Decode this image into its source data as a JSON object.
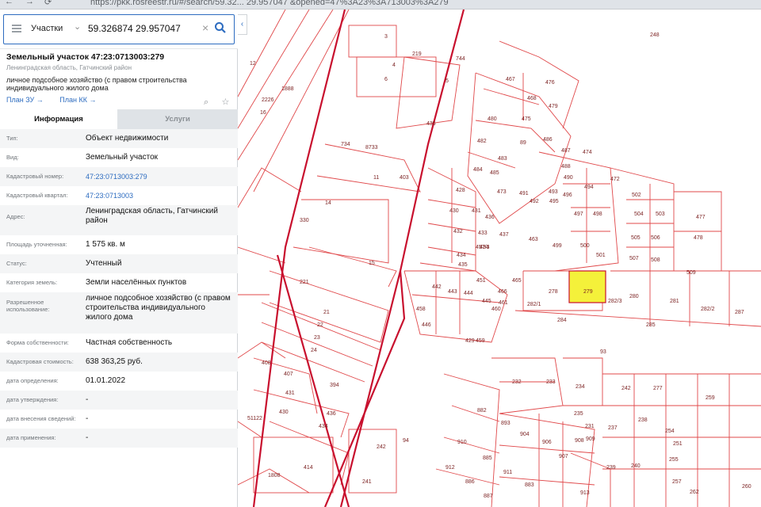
{
  "browser": {
    "url": "https://pkk.rosreestr.ru/#/search/59.32... 29.957047 &opened=47%3A23%3A713003%3A279"
  },
  "search": {
    "type_label": "Участки",
    "value": "59.326874 29.957047"
  },
  "parcel": {
    "title": "Земельный участок 47:23:0713003:279",
    "region": "Ленинградская область, Гатчинский район",
    "purpose": "личное подсобное хозяйство (с правом строительства индивидуального жилого дома",
    "link_plan_zu": "План ЗУ →",
    "link_plan_kk": "План КК →"
  },
  "tabs": {
    "info": "Информация",
    "services": "Услуги"
  },
  "fields": [
    {
      "label": "Тип:",
      "value": "Объект недвижимости"
    },
    {
      "label": "Вид:",
      "value": "Земельный участок"
    },
    {
      "label": "Кадастровый номер:",
      "value": "47:23:0713003:279"
    },
    {
      "label": "Кадастровый квартал:",
      "value": "47:23:0713003"
    },
    {
      "label": "Адрес:",
      "value": "Ленинградская область, Гатчинский район"
    },
    {
      "label": "Площадь уточненная:",
      "value": "1 575 кв. м"
    },
    {
      "label": "Статус:",
      "value": "Учтенный"
    },
    {
      "label": "Категория земель:",
      "value": "Земли населённых пунктов"
    },
    {
      "label": "Разрешенное использование:",
      "value": "личное подсобное хозяйство (с правом строительства индивидуального жилого дома"
    },
    {
      "label": "Форма собственности:",
      "value": "Частная собственность"
    },
    {
      "label": "Кадастровая стоимость:",
      "value": "638 363,25 руб."
    },
    {
      "label": "дата определения:",
      "value": "01.01.2022"
    },
    {
      "label": "дата утверждения:",
      "value": "-"
    },
    {
      "label": "дата внесения сведений:",
      "value": "-"
    },
    {
      "label": "дата применения:",
      "value": "-"
    }
  ],
  "colors": {
    "accent": "#2d6cc0",
    "parcel_line": "#d9342b",
    "selected_parcel": "#f4f13a"
  },
  "map": {
    "labels": [
      "248",
      "219",
      "744",
      "3",
      "4",
      "5",
      "6",
      "12",
      "1888",
      "2226",
      "16",
      "467",
      "476",
      "468",
      "479",
      "435",
      "480",
      "475",
      "482",
      "89",
      "486",
      "487",
      "474",
      "483",
      "484",
      "485",
      "488",
      "490",
      "493",
      "494",
      "472",
      "428",
      "473",
      "491",
      "492",
      "495",
      "496",
      "502",
      "430",
      "431",
      "436",
      "434",
      "497",
      "498",
      "504",
      "503",
      "477",
      "432",
      "433",
      "437",
      "499",
      "500",
      "505",
      "506",
      "478",
      "434",
      "435",
      "457/3",
      "463",
      "501",
      "507",
      "508",
      "509",
      "442",
      "451",
      "466",
      "465",
      "278",
      "279",
      "280",
      "281",
      "282/2",
      "287",
      "458",
      "446",
      "443",
      "444",
      "445",
      "461",
      "282/1",
      "282/3",
      "284",
      "285",
      "429",
      "459",
      "460",
      "93",
      "330",
      "14",
      "15",
      "11",
      "403",
      "734",
      "8733",
      "221",
      "21",
      "22",
      "23",
      "24",
      "408",
      "407",
      "431",
      "394",
      "51122",
      "430",
      "436",
      "434",
      "414",
      "1808",
      "242",
      "241",
      "232",
      "233",
      "234",
      "235",
      "242",
      "277",
      "259",
      "882",
      "893",
      "904",
      "910",
      "885",
      "911",
      "912",
      "886",
      "887",
      "883",
      "906",
      "907",
      "908",
      "909",
      "231",
      "237",
      "238",
      "254",
      "251",
      "255",
      "257",
      "239",
      "240",
      "913",
      "262",
      "260",
      "94"
    ]
  }
}
